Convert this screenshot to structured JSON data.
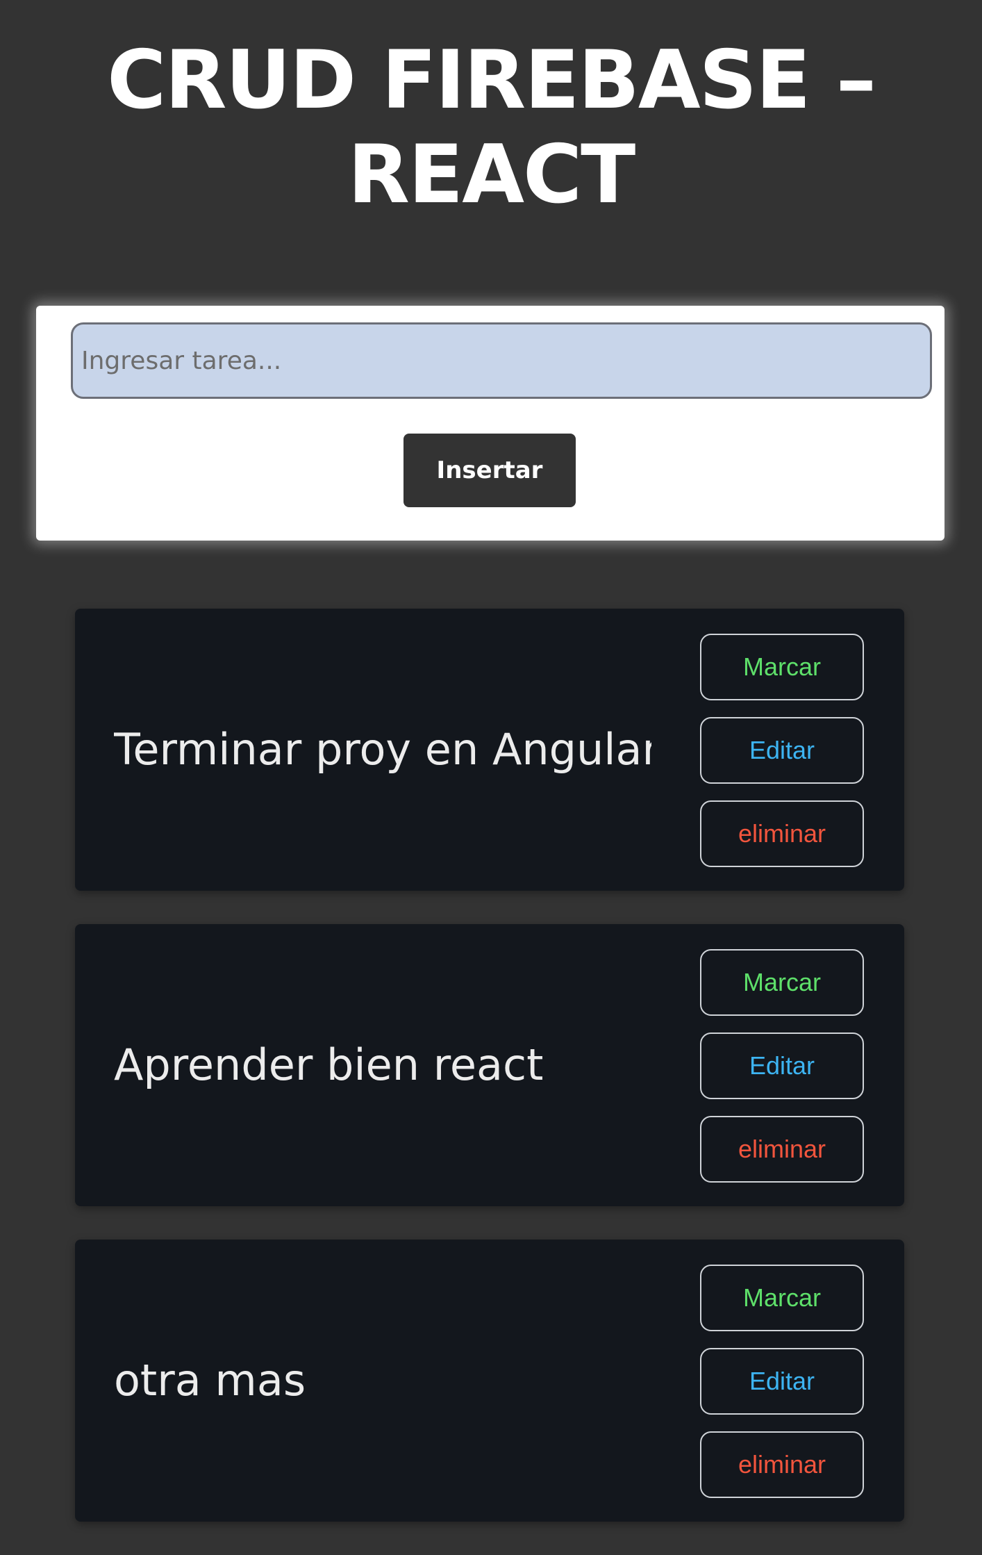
{
  "header": {
    "title_line1": "CRUD FIREBASE –",
    "title_line2": "REACT"
  },
  "form": {
    "input_placeholder": "Ingresar tarea...",
    "input_value": "",
    "insert_label": "Insertar"
  },
  "tasks": [
    {
      "text": "Terminar proy en Angular",
      "mark_label": "Marcar",
      "edit_label": "Editar",
      "delete_label": "eliminar"
    },
    {
      "text": "Aprender bien react",
      "mark_label": "Marcar",
      "edit_label": "Editar",
      "delete_label": "eliminar"
    },
    {
      "text": "otra mas",
      "mark_label": "Marcar",
      "edit_label": "Editar",
      "delete_label": "eliminar"
    }
  ],
  "colors": {
    "background": "#333333",
    "card": "#13171d",
    "input_bg": "#c8d5ea",
    "mark": "#5ee06a",
    "edit": "#3db4f2",
    "delete": "#f2553d"
  }
}
